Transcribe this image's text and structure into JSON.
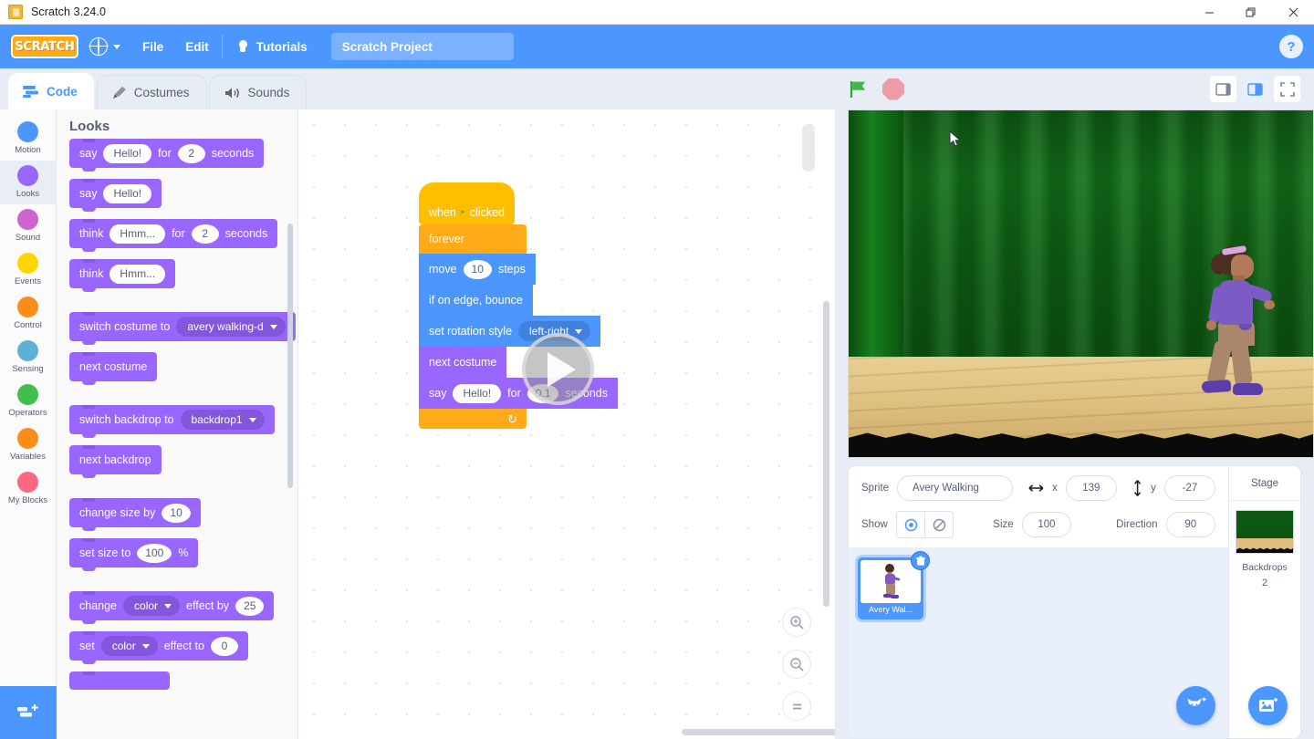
{
  "window": {
    "app_icon": "scratch-app-icon",
    "title": "Scratch 3.24.0",
    "minimize": "minimize-icon",
    "maximize": "restore-icon",
    "close": "close-icon"
  },
  "menubar": {
    "logo_text": "SCRATCH",
    "language_icon": "globe-icon",
    "items": [
      {
        "label": "File"
      },
      {
        "label": "Edit"
      }
    ],
    "tutorials_label": "Tutorials",
    "tutorials_icon": "lightbulb-icon",
    "project_name": "Scratch Project",
    "help_label": "?"
  },
  "tabs": [
    {
      "label": "Code",
      "icon": "code-icon",
      "active": true
    },
    {
      "label": "Costumes",
      "icon": "paintbrush-icon",
      "active": false
    },
    {
      "label": "Sounds",
      "icon": "speaker-icon",
      "active": false
    }
  ],
  "categories": [
    {
      "label": "Motion",
      "color": "#4c97ff",
      "selected": false
    },
    {
      "label": "Looks",
      "color": "#9966ff",
      "selected": true
    },
    {
      "label": "Sound",
      "color": "#cf63cf",
      "selected": false
    },
    {
      "label": "Events",
      "color": "#ffd500",
      "selected": false
    },
    {
      "label": "Control",
      "color": "#ff8c1a",
      "selected": false
    },
    {
      "label": "Sensing",
      "color": "#5cb1d6",
      "selected": false
    },
    {
      "label": "Operators",
      "color": "#40bf4a",
      "selected": false
    },
    {
      "label": "Variables",
      "color": "#ff8c1a",
      "selected": false
    },
    {
      "label": "My Blocks",
      "color": "#ff6680",
      "selected": false
    }
  ],
  "extension_button": "add-extension-icon",
  "palette": {
    "heading": "Looks",
    "blocks": [
      {
        "id": "say-for-secs",
        "parts": [
          {
            "t": "text",
            "v": "say"
          },
          {
            "t": "oval",
            "v": "Hello!"
          },
          {
            "t": "text",
            "v": "for"
          },
          {
            "t": "num",
            "v": "2"
          },
          {
            "t": "text",
            "v": "seconds"
          }
        ]
      },
      {
        "id": "say",
        "parts": [
          {
            "t": "text",
            "v": "say"
          },
          {
            "t": "oval",
            "v": "Hello!"
          }
        ]
      },
      {
        "id": "think-for-secs",
        "parts": [
          {
            "t": "text",
            "v": "think"
          },
          {
            "t": "oval",
            "v": "Hmm..."
          },
          {
            "t": "text",
            "v": "for"
          },
          {
            "t": "num",
            "v": "2"
          },
          {
            "t": "text",
            "v": "seconds"
          }
        ]
      },
      {
        "id": "think",
        "parts": [
          {
            "t": "text",
            "v": "think"
          },
          {
            "t": "oval",
            "v": "Hmm..."
          }
        ]
      },
      {
        "id": "spacer1",
        "parts": []
      },
      {
        "id": "switch-costume",
        "parts": [
          {
            "t": "text",
            "v": "switch costume to"
          },
          {
            "t": "dropdown",
            "v": "avery walking-d"
          }
        ]
      },
      {
        "id": "next-costume",
        "parts": [
          {
            "t": "text",
            "v": "next costume"
          }
        ]
      },
      {
        "id": "spacer2",
        "parts": []
      },
      {
        "id": "switch-backdrop",
        "parts": [
          {
            "t": "text",
            "v": "switch backdrop to"
          },
          {
            "t": "dropdown",
            "v": "backdrop1"
          }
        ]
      },
      {
        "id": "next-backdrop",
        "parts": [
          {
            "t": "text",
            "v": "next backdrop"
          }
        ]
      },
      {
        "id": "spacer3",
        "parts": []
      },
      {
        "id": "change-size",
        "parts": [
          {
            "t": "text",
            "v": "change size by"
          },
          {
            "t": "num",
            "v": "10"
          }
        ]
      },
      {
        "id": "set-size",
        "parts": [
          {
            "t": "text",
            "v": "set size to"
          },
          {
            "t": "num",
            "v": "100"
          },
          {
            "t": "text",
            "v": "%"
          }
        ]
      },
      {
        "id": "spacer4",
        "parts": []
      },
      {
        "id": "change-effect",
        "parts": [
          {
            "t": "text",
            "v": "change"
          },
          {
            "t": "dropdown",
            "v": "color"
          },
          {
            "t": "text",
            "v": "effect by"
          },
          {
            "t": "num",
            "v": "25"
          }
        ]
      },
      {
        "id": "set-effect",
        "parts": [
          {
            "t": "text",
            "v": "set"
          },
          {
            "t": "dropdown",
            "v": "color"
          },
          {
            "t": "text",
            "v": "effect to"
          },
          {
            "t": "num",
            "v": "0"
          }
        ]
      }
    ]
  },
  "script": {
    "hat": {
      "pre": "when",
      "icon": "green-flag-icon",
      "post": "clicked"
    },
    "loop_label": "forever",
    "loop_arrow": "↻",
    "body": [
      {
        "id": "move",
        "color": "motion",
        "parts": [
          {
            "t": "text",
            "v": "move"
          },
          {
            "t": "num",
            "v": "10"
          },
          {
            "t": "text",
            "v": "steps"
          }
        ]
      },
      {
        "id": "bounce",
        "color": "motion",
        "parts": [
          {
            "t": "text",
            "v": "if on edge, bounce"
          }
        ]
      },
      {
        "id": "rotation",
        "color": "motion",
        "parts": [
          {
            "t": "text",
            "v": "set rotation style"
          },
          {
            "t": "dropdown",
            "v": "left-right"
          }
        ]
      },
      {
        "id": "next-costume",
        "color": "looks",
        "parts": [
          {
            "t": "text",
            "v": "next costume"
          }
        ]
      },
      {
        "id": "say",
        "color": "looks",
        "parts": [
          {
            "t": "text",
            "v": "say"
          },
          {
            "t": "oval",
            "v": "Hello!"
          },
          {
            "t": "text",
            "v": "for"
          },
          {
            "t": "num",
            "v": "0.1"
          },
          {
            "t": "text",
            "v": "seconds"
          }
        ]
      }
    ]
  },
  "canvas_controls": {
    "zoom_in": "zoom-in-icon",
    "zoom_out": "zoom-out-icon",
    "zoom_reset": "zoom-reset-icon",
    "play_overlay": "play-icon"
  },
  "stage_controls": {
    "green_flag": "green-flag-icon",
    "stop": "stop-icon",
    "small_stage": "small-stage-icon",
    "large_stage": "large-stage-icon",
    "fullscreen": "fullscreen-icon"
  },
  "stage": {
    "backdrop_name": "Theater",
    "sprite_on_stage": "avery-walking-sprite",
    "cursor": "mouse-cursor"
  },
  "sprite_info": {
    "sprite_label": "Sprite",
    "sprite_name": "Avery Walking",
    "x_label": "x",
    "x_value": "139",
    "y_label": "y",
    "y_value": "-27",
    "x_icon": "horizontal-arrows-icon",
    "y_icon": "vertical-arrows-icon",
    "show_label": "Show",
    "show_on_icon": "eye-show-icon",
    "show_off_icon": "eye-hide-icon",
    "size_label": "Size",
    "size_value": "100",
    "direction_label": "Direction",
    "direction_value": "90"
  },
  "sprite_list": {
    "sprites": [
      {
        "name": "Avery Wal...",
        "selected": true,
        "delete_icon": "trash-icon"
      }
    ],
    "add_sprite_icon": "add-sprite-cat-icon"
  },
  "stage_pane": {
    "title": "Stage",
    "backdrops_label": "Backdrops",
    "backdrops_count": "2",
    "add_backdrop_icon": "add-backdrop-icon"
  },
  "colors": {
    "brand_blue": "#4c97ff",
    "looks_purple": "#9966ff",
    "motion_blue": "#4c97ff",
    "events_yellow": "#ffbf00",
    "control_orange": "#ffab19",
    "stop_red": "#ec9ca6"
  }
}
